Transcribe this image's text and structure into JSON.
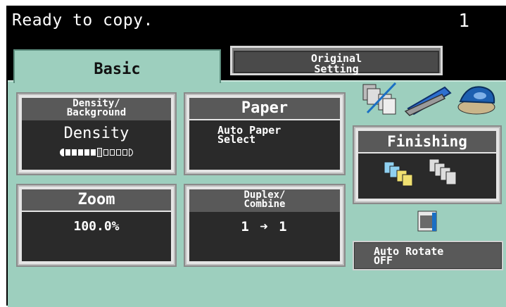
{
  "status": {
    "message": "Ready to copy.",
    "copy_count": "1"
  },
  "tabs": {
    "basic": "Basic",
    "original_line1": "Original",
    "original_line2": "Setting"
  },
  "buttons": {
    "density": {
      "title_line1": "Density/",
      "title_line2": "Background",
      "value": "Density",
      "level": 0.6
    },
    "paper": {
      "title": "Paper",
      "value_line1": "Auto Paper",
      "value_line2": "Select"
    },
    "zoom": {
      "title": "Zoom",
      "value": "100.0%"
    },
    "duplex": {
      "title_line1": "Duplex/",
      "title_line2": "Combine",
      "from": "1",
      "to": "1"
    },
    "finishing": {
      "title": "Finishing"
    },
    "auto_rotate": {
      "line1": "Auto Rotate",
      "line2": "OFF"
    }
  },
  "colors": {
    "panel": "#9dcfbe",
    "accent_blue": "#1a6fc4",
    "stapler": "#2e6fcf",
    "punch": "#1d5fb0"
  },
  "icons": [
    "sort-group-icon",
    "staple-icon",
    "punch-icon",
    "sort-offset-icon",
    "rotate-icon"
  ]
}
